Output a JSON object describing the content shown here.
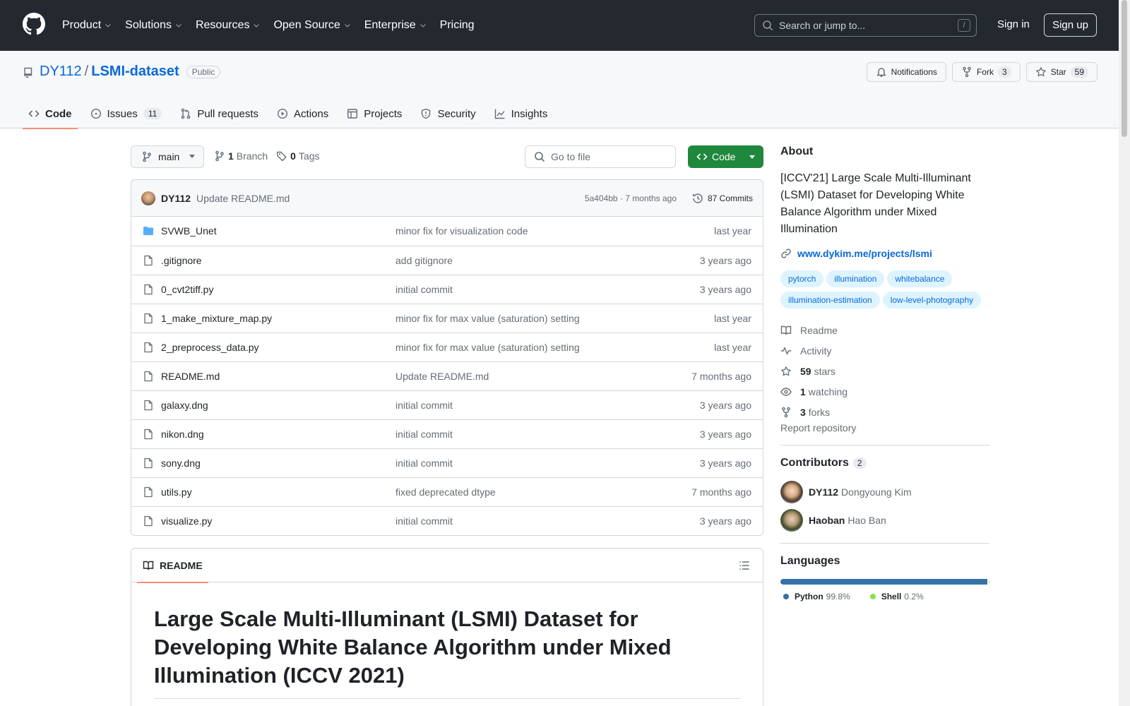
{
  "header": {
    "nav": [
      {
        "label": "Product",
        "has_menu": true
      },
      {
        "label": "Solutions",
        "has_menu": true
      },
      {
        "label": "Resources",
        "has_menu": true
      },
      {
        "label": "Open Source",
        "has_menu": true
      },
      {
        "label": "Enterprise",
        "has_menu": true
      },
      {
        "label": "Pricing",
        "has_menu": false
      }
    ],
    "search_placeholder": "Search or jump to...",
    "search_shortcut": "/",
    "sign_in": "Sign in",
    "sign_up": "Sign up"
  },
  "repo": {
    "owner": "DY112",
    "separator": "/",
    "name": "LSMI-dataset",
    "visibility": "Public",
    "notifications_label": "Notifications",
    "fork_label": "Fork",
    "fork_count": "3",
    "star_label": "Star",
    "star_count": "59"
  },
  "tabs": [
    {
      "label": "Code",
      "icon": "code-icon",
      "active": true,
      "count": ""
    },
    {
      "label": "Issues",
      "icon": "issue-icon",
      "active": false,
      "count": "11"
    },
    {
      "label": "Pull requests",
      "icon": "pull-request-icon",
      "active": false,
      "count": ""
    },
    {
      "label": "Actions",
      "icon": "play-icon",
      "active": false,
      "count": ""
    },
    {
      "label": "Projects",
      "icon": "table-icon",
      "active": false,
      "count": ""
    },
    {
      "label": "Security",
      "icon": "shield-icon",
      "active": false,
      "count": ""
    },
    {
      "label": "Insights",
      "icon": "graph-icon",
      "active": false,
      "count": ""
    }
  ],
  "toolbar": {
    "branch": "main",
    "branch_count": "1",
    "branch_label": "Branch",
    "tag_count": "0",
    "tag_label": "Tags",
    "goto_placeholder": "Go to file",
    "code_label": "Code"
  },
  "latest_commit": {
    "author": "DY112",
    "message": "Update README.md",
    "sha_time": "5a404bb · 7 months ago",
    "commits_label": "87 Commits"
  },
  "files": [
    {
      "name": "SVWB_Unet",
      "type": "dir",
      "message": "minor fix for visualization code",
      "age": "last year"
    },
    {
      "name": ".gitignore",
      "type": "file",
      "message": "add gitignore",
      "age": "3 years ago"
    },
    {
      "name": "0_cvt2tiff.py",
      "type": "file",
      "message": "initial commit",
      "age": "3 years ago"
    },
    {
      "name": "1_make_mixture_map.py",
      "type": "file",
      "message": "minor fix for max value (saturation) setting",
      "age": "last year"
    },
    {
      "name": "2_preprocess_data.py",
      "type": "file",
      "message": "minor fix for max value (saturation) setting",
      "age": "last year"
    },
    {
      "name": "README.md",
      "type": "file",
      "message": "Update README.md",
      "age": "7 months ago"
    },
    {
      "name": "galaxy.dng",
      "type": "file",
      "message": "initial commit",
      "age": "3 years ago"
    },
    {
      "name": "nikon.dng",
      "type": "file",
      "message": "initial commit",
      "age": "3 years ago"
    },
    {
      "name": "sony.dng",
      "type": "file",
      "message": "initial commit",
      "age": "3 years ago"
    },
    {
      "name": "utils.py",
      "type": "file",
      "message": "fixed deprecated dtype",
      "age": "7 months ago"
    },
    {
      "name": "visualize.py",
      "type": "file",
      "message": "initial commit",
      "age": "3 years ago"
    }
  ],
  "readme": {
    "tab_label": "README",
    "heading": "Large Scale Multi-Illuminant (LSMI) Dataset for Developing White Balance Algorithm under Mixed Illumination (ICCV 2021)"
  },
  "about": {
    "title": "About",
    "description": "[ICCV'21] Large Scale Multi-Illuminant (LSMI) Dataset for Developing White Balance Algorithm under Mixed Illumination",
    "link": "www.dykim.me/projects/lsmi",
    "topics": [
      "pytorch",
      "illumination",
      "whitebalance",
      "illumination-estimation",
      "low-level-photography"
    ],
    "stats": [
      {
        "icon": "book-icon",
        "count": "",
        "label": "Readme"
      },
      {
        "icon": "pulse-icon",
        "count": "",
        "label": "Activity"
      },
      {
        "icon": "star-icon",
        "count": "59",
        "label": "stars"
      },
      {
        "icon": "eye-icon",
        "count": "1",
        "label": "watching"
      },
      {
        "icon": "fork-icon",
        "count": "3",
        "label": "forks"
      }
    ],
    "report": "Report repository"
  },
  "contributors": {
    "title": "Contributors",
    "count": "2",
    "people": [
      {
        "login": "DY112",
        "name": "Dongyoung Kim"
      },
      {
        "login": "Haoban",
        "name": "Hao Ban"
      }
    ]
  },
  "languages": {
    "title": "Languages",
    "items": [
      {
        "name": "Python",
        "percent": "99.8%",
        "value": 99.8,
        "color": "#3572A5"
      },
      {
        "name": "Shell",
        "percent": "0.2%",
        "value": 0.2,
        "color": "#89e051"
      }
    ]
  },
  "colors": {
    "header_bg": "#24292f",
    "accent_link": "#0969da",
    "code_button": "#1f883d",
    "active_tab_underline": "#fd8c73"
  }
}
